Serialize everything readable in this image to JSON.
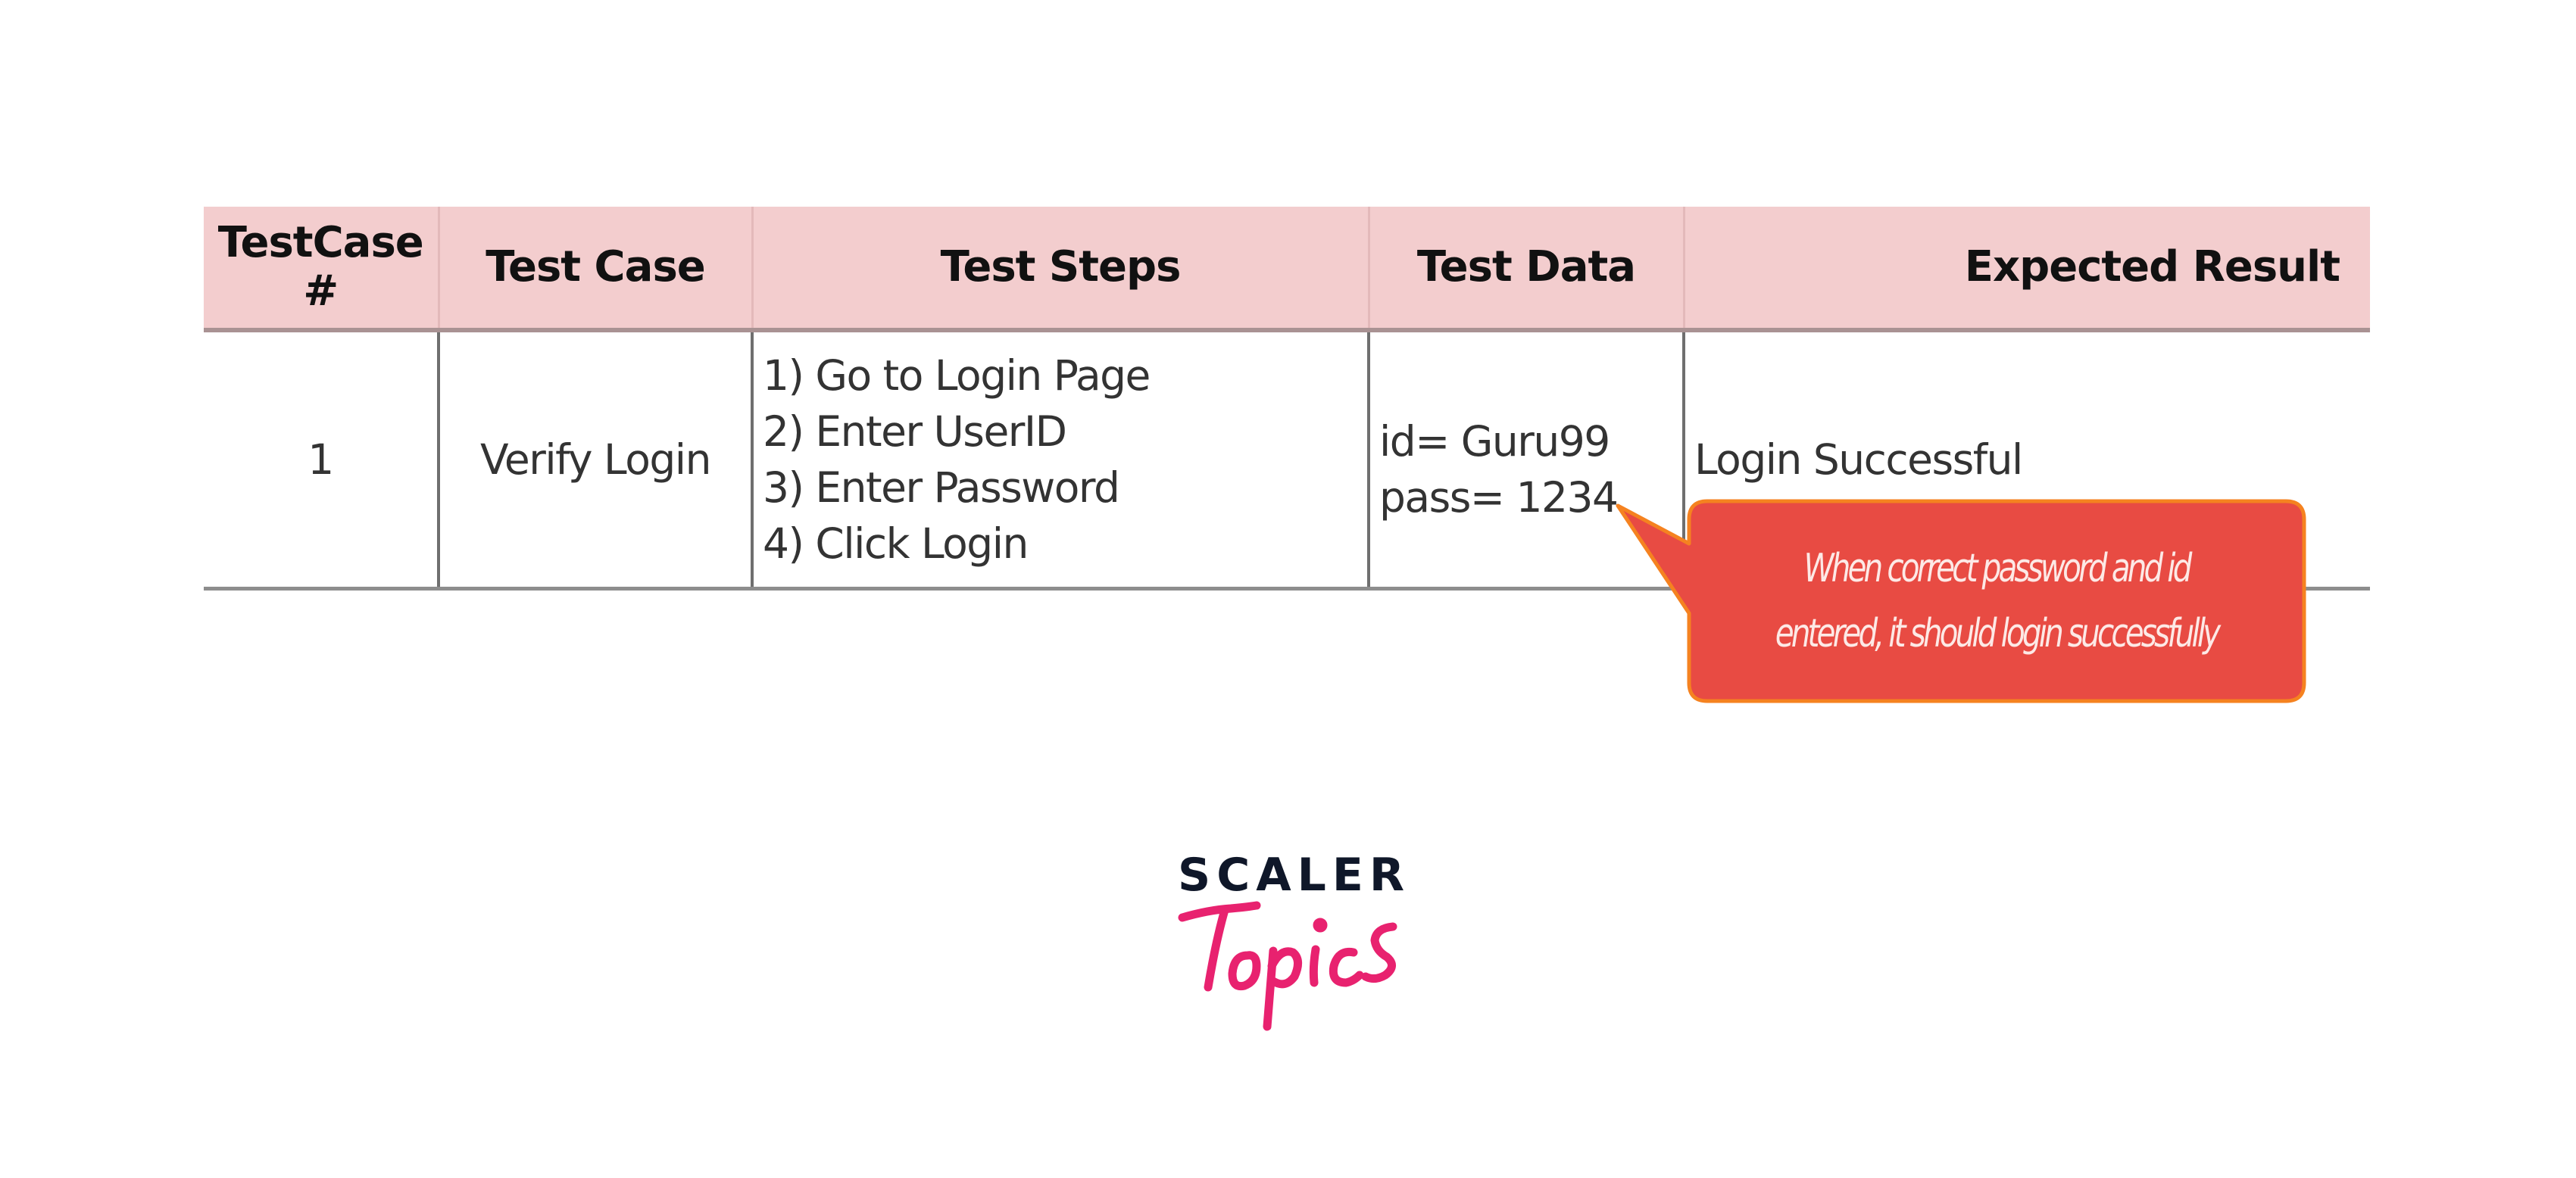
{
  "table": {
    "headers": [
      {
        "line1": "TestCase",
        "line2": "#"
      },
      {
        "line1": "Test Case"
      },
      {
        "line1": "Test Steps"
      },
      {
        "line1": "Test Data"
      },
      {
        "line1": "Expected Result"
      }
    ],
    "rows": [
      {
        "number": "1",
        "test_case": "Verify Login",
        "steps": [
          "1) Go to Login Page",
          "2) Enter UserID",
          "3) Enter Password",
          "4) Click Login"
        ],
        "test_data": [
          "id= Guru99",
          "pass= 1234"
        ],
        "expected_result": "Login Successful"
      }
    ]
  },
  "callout": {
    "lines": [
      "When correct password and id",
      "entered, it should login successfully"
    ],
    "fill_color": "#e84b43",
    "border_color": "#f58220"
  },
  "logo": {
    "top_text": "SCALER",
    "script_text": "Topics",
    "top_color": "#0f1729",
    "script_color": "#e8226f"
  }
}
